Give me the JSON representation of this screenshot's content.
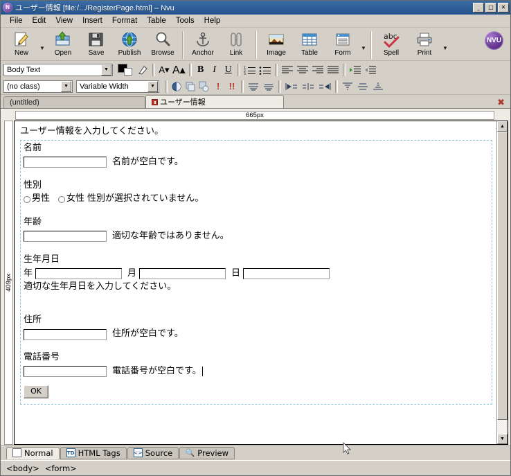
{
  "window": {
    "title": "ユーザー情報 [file:/.../RegisterPage.html] – Nvu",
    "app_icon": "nvu-logo-icon",
    "minimize": "_",
    "maximize": "□",
    "close": "✕"
  },
  "menubar": [
    {
      "label": "File"
    },
    {
      "label": "Edit"
    },
    {
      "label": "View"
    },
    {
      "label": "Insert"
    },
    {
      "label": "Format"
    },
    {
      "label": "Table"
    },
    {
      "label": "Tools"
    },
    {
      "label": "Help"
    }
  ],
  "toolbar": [
    {
      "label": "New",
      "icon": "new-page-icon",
      "dropdown": true
    },
    {
      "label": "Open",
      "icon": "open-folder-icon",
      "dropdown": false
    },
    {
      "label": "Save",
      "icon": "floppy-disk-icon",
      "dropdown": false
    },
    {
      "label": "Publish",
      "icon": "globe-upload-icon",
      "dropdown": false
    },
    {
      "label": "Browse",
      "icon": "magnifier-icon",
      "dropdown": false
    },
    {
      "label": "Anchor",
      "icon": "anchor-icon",
      "dropdown": false
    },
    {
      "label": "Link",
      "icon": "chain-link-icon",
      "dropdown": false
    },
    {
      "label": "Image",
      "icon": "picture-icon",
      "dropdown": false
    },
    {
      "label": "Table",
      "icon": "table-grid-icon",
      "dropdown": false
    },
    {
      "label": "Form",
      "icon": "form-window-icon",
      "dropdown": true
    },
    {
      "label": "Spell",
      "icon": "abc-check-icon",
      "dropdown": false
    },
    {
      "label": "Print",
      "icon": "printer-icon",
      "dropdown": true
    }
  ],
  "logo_text": "NVU",
  "format_bar": {
    "paragraph_style": "Body Text",
    "text_color_swatch": "#000000",
    "background_color_swatch": "#ffffff",
    "highlight_icon": "highlighter-icon",
    "smaller_text": "A▾",
    "larger_text": "A▴",
    "bold": "B",
    "italic": "I",
    "underline": "U",
    "numbered_list": "numbered-list-icon",
    "bulleted_list": "bulleted-list-icon",
    "align_left": "align-left-icon",
    "align_center": "align-center-icon",
    "align_right": "align-right-icon",
    "align_justify": "align-justify-icon",
    "indent": "indent-icon",
    "outdent": "outdent-icon"
  },
  "css_bar": {
    "class_select": "(no class)",
    "width_select": "Variable Width",
    "buttons": [
      {
        "icon": "css-rule-icon"
      },
      {
        "icon": "copy-style-icon"
      },
      {
        "icon": "paste-style-icon"
      },
      {
        "icon": "important-icon"
      },
      {
        "icon": "double-important-icon"
      },
      {
        "icon": "merge-rows-icon"
      },
      {
        "icon": "split-rows-icon"
      },
      {
        "icon": "align-cells-left-icon"
      },
      {
        "icon": "align-cells-center-icon"
      },
      {
        "icon": "align-cells-right-icon"
      },
      {
        "icon": "table-top-icon"
      },
      {
        "icon": "table-middle-icon"
      },
      {
        "icon": "table-bottom-icon"
      }
    ]
  },
  "document_tabs": [
    {
      "label": "(untitled)",
      "active": false,
      "modified": false
    },
    {
      "label": "ユーザー情報",
      "active": true,
      "modified": true
    }
  ],
  "tabbar_close_icon": "close-tab-icon",
  "rulers": {
    "horizontal": "665px",
    "vertical": "409px"
  },
  "document": {
    "intro": "ユーザー情報を入力してください。",
    "fields": [
      {
        "label": "名前",
        "type": "text",
        "value": "",
        "message": "名前が空白です。"
      },
      {
        "label": "性別",
        "type": "radio",
        "options": [
          {
            "label": "男性",
            "checked": false
          },
          {
            "label": "女性",
            "checked": false
          }
        ],
        "message": "性別が選択されていません。"
      },
      {
        "label": "年齢",
        "type": "text",
        "value": "",
        "message": "適切な年齢ではありません。"
      },
      {
        "label": "生年月日",
        "type": "date",
        "parts": [
          {
            "unit": "年",
            "value": ""
          },
          {
            "unit": "月",
            "value": ""
          },
          {
            "unit": "日",
            "value": ""
          }
        ],
        "message": "適切な生年月日を入力してください。"
      },
      {
        "label": "住所",
        "type": "text",
        "value": "",
        "message": "住所が空白です。"
      },
      {
        "label": "電話番号",
        "type": "text",
        "value": "",
        "message": "電話番号が空白です。"
      }
    ],
    "submit_label": "OK"
  },
  "view_tabs": [
    {
      "label": "Normal",
      "icon": "blank-page-icon",
      "active": true
    },
    {
      "label": "HTML Tags",
      "icon": "td-tag-icon",
      "active": false
    },
    {
      "label": "Source",
      "icon": "angle-brackets-icon",
      "active": false
    },
    {
      "label": "Preview",
      "icon": "magnifier-icon",
      "active": false
    }
  ],
  "statusbar": {
    "path": [
      "<body>",
      "<form>"
    ]
  },
  "scrollbar": {
    "up_arrow": "▲",
    "down_arrow": "▼"
  }
}
